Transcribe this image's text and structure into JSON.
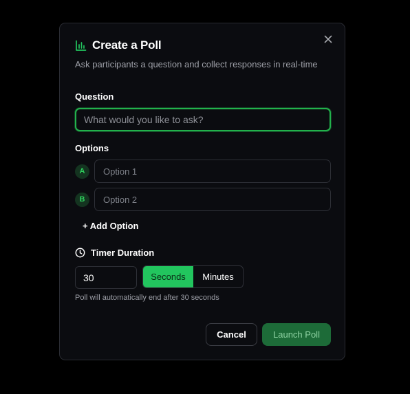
{
  "modal": {
    "title": "Create a Poll",
    "subtitle": "Ask participants a question and collect responses in real-time",
    "icon": "bar-chart-icon",
    "close_icon": "close-icon"
  },
  "question": {
    "label": "Question",
    "placeholder": "What would you like to ask?",
    "value": ""
  },
  "options": {
    "label": "Options",
    "items": [
      {
        "badge": "A",
        "placeholder": "Option 1",
        "value": ""
      },
      {
        "badge": "B",
        "placeholder": "Option 2",
        "value": ""
      }
    ],
    "add_label": "+ Add Option"
  },
  "timer": {
    "label": "Timer Duration",
    "icon": "clock-icon",
    "value": "30",
    "units": [
      "Seconds",
      "Minutes"
    ],
    "selected_unit": "Seconds",
    "hint": "Poll will automatically end after 30 seconds"
  },
  "actions": {
    "cancel_label": "Cancel",
    "launch_label": "Launch Poll"
  },
  "colors": {
    "accent": "#22c55e",
    "launch_bg": "#1d6b38",
    "background": "#000000",
    "modal_bg": "#0b0c10"
  }
}
